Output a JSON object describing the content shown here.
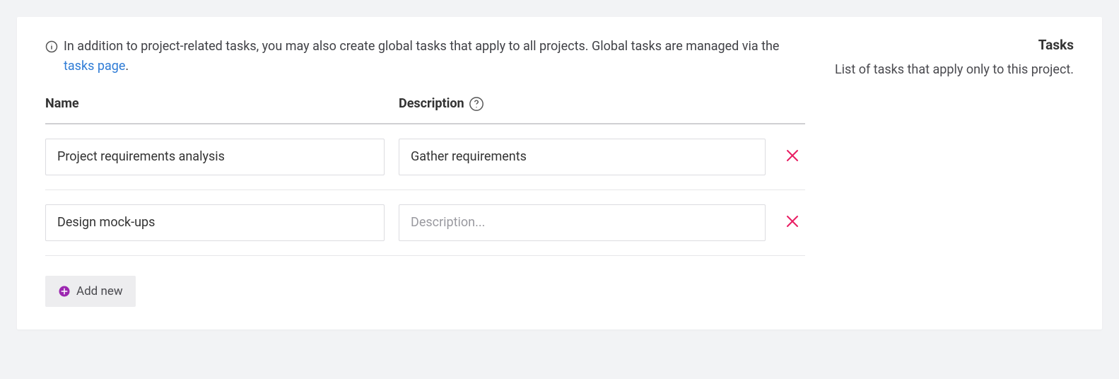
{
  "info": {
    "text_before": "In addition to project-related tasks, you may also create global tasks that apply to all projects. Global tasks are managed via the ",
    "link_text": "tasks page",
    "text_after": "."
  },
  "side": {
    "title": "Tasks",
    "description": "List of tasks that apply only to this project."
  },
  "table": {
    "headers": {
      "name": "Name",
      "description": "Description"
    },
    "rows": [
      {
        "name": "Project requirements analysis",
        "description": "Gather requirements"
      },
      {
        "name": "Design mock-ups",
        "description": ""
      }
    ],
    "description_placeholder": "Description..."
  },
  "actions": {
    "add_new": "Add new"
  }
}
